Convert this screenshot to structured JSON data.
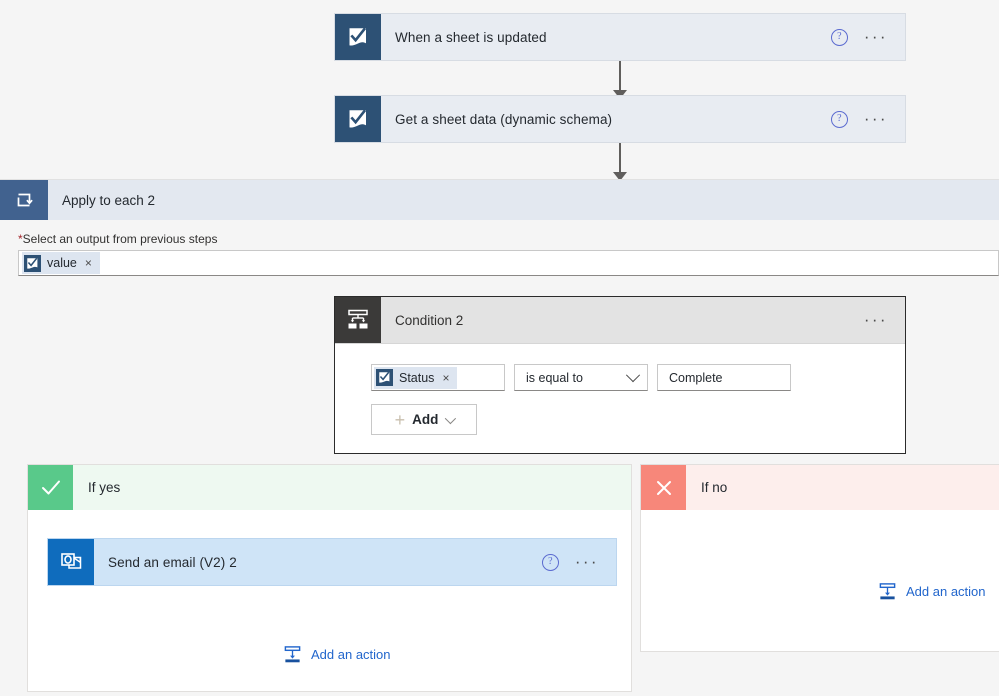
{
  "flow": {
    "trigger": {
      "title": "When a sheet is updated",
      "icon": "smartsheet-icon",
      "help_label": "?",
      "menu_label": "···"
    },
    "action_get_sheet": {
      "title": "Get a sheet data (dynamic schema)",
      "icon": "smartsheet-icon",
      "help_label": "?",
      "menu_label": "···"
    },
    "scope": {
      "title": "Apply to each 2",
      "icon": "loop-icon",
      "field_label": "Select an output from previous steps",
      "required_marker": "*",
      "token": {
        "label": "value",
        "remove_label": "×",
        "icon": "smartsheet-icon"
      }
    },
    "condition": {
      "title": "Condition 2",
      "icon": "condition-branch-icon",
      "menu_label": "···",
      "expression": {
        "left_token": {
          "label": "Status",
          "remove_label": "×",
          "icon": "smartsheet-icon"
        },
        "operator": "is equal to",
        "value": "Complete"
      },
      "add_button": {
        "label": "Add",
        "plus": "+"
      }
    },
    "branch_yes": {
      "label": "If yes",
      "badge_icon": "checkmark-icon",
      "action": {
        "title": "Send an email (V2) 2",
        "icon": "outlook-icon",
        "help_label": "?",
        "menu_label": "···"
      },
      "add_action": {
        "label": "Add an action",
        "icon": "insert-action-icon"
      }
    },
    "branch_no": {
      "label": "If no",
      "badge_icon": "cross-icon",
      "add_action": {
        "label": "Add an action",
        "icon": "insert-action-icon"
      }
    }
  },
  "colors": {
    "smartsheet_blue": "#2d5175",
    "outlook_blue": "#0f6cbd",
    "scope_header_blue": "#41628f",
    "condition_icon_bg": "#3b3a39",
    "yes_green": "#59c98a",
    "no_red": "#f7877a",
    "link_blue": "#2266cc",
    "selected_card": "#cfe4f7"
  }
}
